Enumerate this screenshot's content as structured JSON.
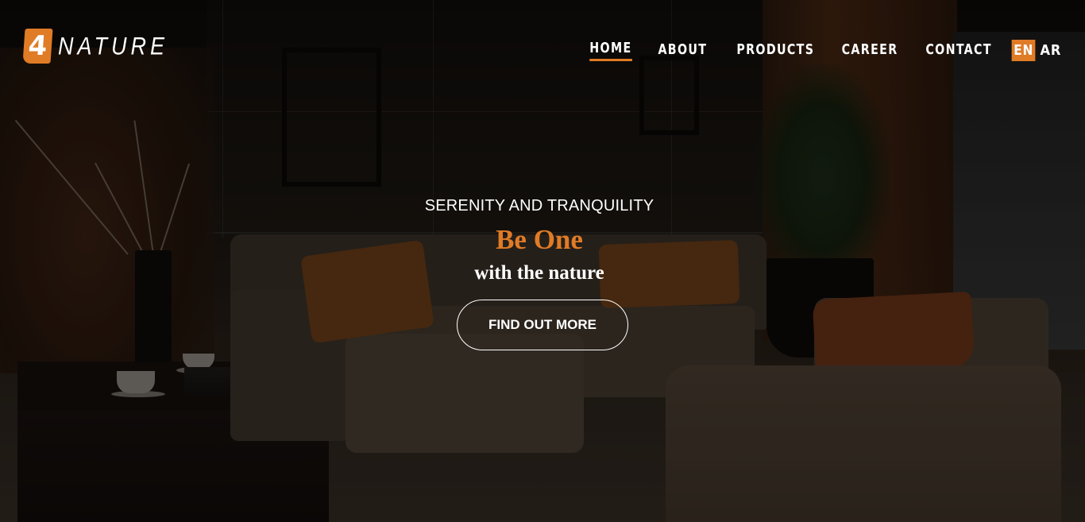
{
  "brand": {
    "mark": "4",
    "name": "NATURE",
    "accent_color": "#e07b26"
  },
  "nav": {
    "items": [
      {
        "label": "HOME",
        "active": true
      },
      {
        "label": "ABOUT",
        "active": false
      },
      {
        "label": "PRODUCTS",
        "active": false
      },
      {
        "label": "CAREER",
        "active": false
      },
      {
        "label": "CONTACT",
        "active": false
      }
    ],
    "languages": {
      "en": "EN",
      "ar": "AR",
      "selected": "EN"
    }
  },
  "hero": {
    "kicker": "SERENITY AND TRANQUILITY",
    "headline": "Be One",
    "subline": "with the nature",
    "cta_label": "FIND OUT MORE"
  }
}
